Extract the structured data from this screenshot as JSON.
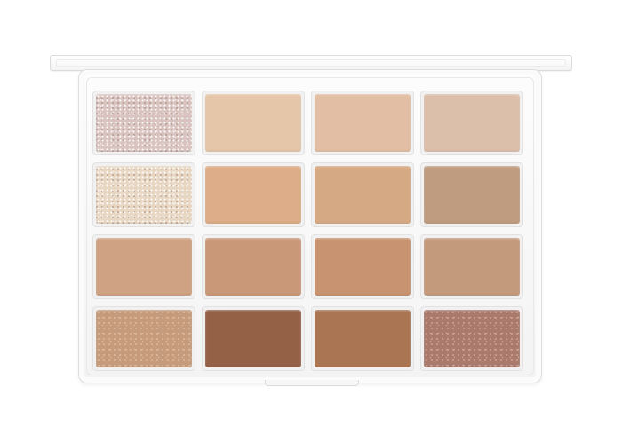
{
  "palette": {
    "shades": [
      {
        "name": "pan-1",
        "color": "#d9c3bf",
        "finish": "glitter"
      },
      {
        "name": "pan-2",
        "color": "#e6c6a8",
        "finish": "matte"
      },
      {
        "name": "pan-3",
        "color": "#e2bea4",
        "finish": "matte"
      },
      {
        "name": "pan-4",
        "color": "#dcbfaa",
        "finish": "matte"
      },
      {
        "name": "pan-5",
        "color": "#e7d6c2",
        "finish": "glitter"
      },
      {
        "name": "pan-6",
        "color": "#dcad88",
        "finish": "matte"
      },
      {
        "name": "pan-7",
        "color": "#d6a985",
        "finish": "matte"
      },
      {
        "name": "pan-8",
        "color": "#bf9c80",
        "finish": "matte"
      },
      {
        "name": "pan-9",
        "color": "#cfa283",
        "finish": "matte"
      },
      {
        "name": "pan-10",
        "color": "#c99878",
        "finish": "matte"
      },
      {
        "name": "pan-11",
        "color": "#c89370",
        "finish": "matte"
      },
      {
        "name": "pan-12",
        "color": "#c49a7c",
        "finish": "matte"
      },
      {
        "name": "pan-13",
        "color": "#c59b7b",
        "finish": "shimmer"
      },
      {
        "name": "pan-14",
        "color": "#946146",
        "finish": "matte"
      },
      {
        "name": "pan-15",
        "color": "#aa7553",
        "finish": "matte"
      },
      {
        "name": "pan-16",
        "color": "#aa7a6d",
        "finish": "shimmer"
      }
    ]
  }
}
